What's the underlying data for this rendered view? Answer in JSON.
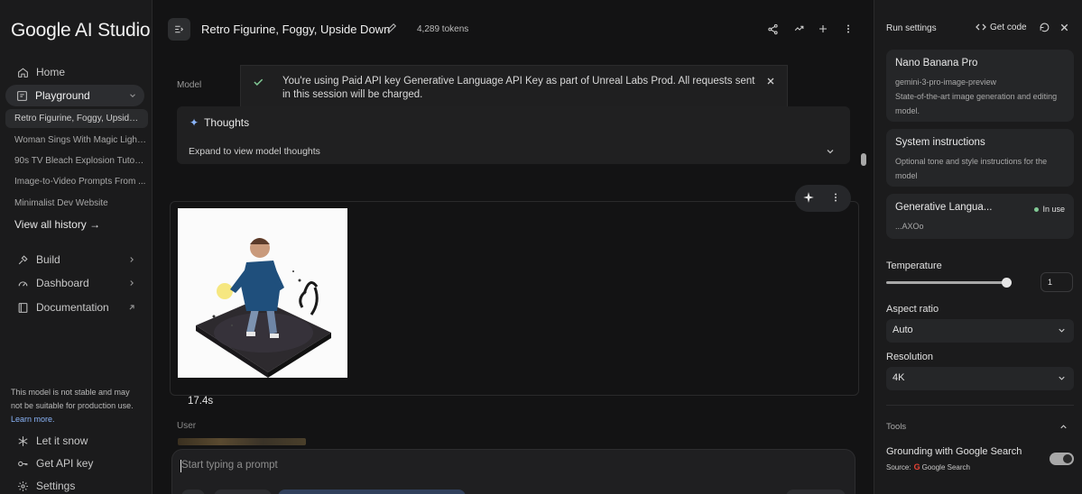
{
  "app": {
    "title": "Google AI Studio"
  },
  "sidebar": {
    "nav": [
      {
        "label": "Home",
        "icon": "home-icon"
      },
      {
        "label": "Playground",
        "icon": "playground-icon"
      }
    ],
    "history": [
      "Retro Figurine, Foggy, Upside D...",
      "Woman Sings With Magic Lights.",
      "90s TV Bleach Explosion Tutorial",
      "Image-to-Video Prompts From ...",
      "Minimalist Dev Website"
    ],
    "view_all": "View all history →",
    "lower_nav": [
      {
        "label": "Build",
        "icon": "build-icon"
      },
      {
        "label": "Dashboard",
        "icon": "dashboard-icon"
      },
      {
        "label": "Documentation",
        "icon": "documentation-icon"
      }
    ],
    "note_text": "This model is not stable and may not be suitable for production use.",
    "note_link": "Learn more.",
    "footer": [
      {
        "label": "Let it snow",
        "icon": "snowflake-icon"
      },
      {
        "label": "Get API key",
        "icon": "key-icon"
      },
      {
        "label": "Settings",
        "icon": "gear-icon"
      }
    ]
  },
  "header": {
    "title": "Retro Figurine, Foggy, Upside Down",
    "tokens": "4,289 tokens"
  },
  "main": {
    "model_label": "Model",
    "toast": "You're using Paid API key Generative Language API Key as part of Unreal Labs Prod. All requests sent in this session will be charged.",
    "thoughts": {
      "title": "Thoughts",
      "expand": "Expand to view model thoughts"
    },
    "elapsed": "17.4s",
    "user_label": "User",
    "prompt_placeholder": "Start typing a prompt"
  },
  "settings": {
    "title": "Run settings",
    "get_code": "Get code",
    "model": {
      "name": "Nano Banana Pro",
      "id": "gemini-3-pro-image-preview",
      "desc": "State-of-the-art image generation and editing model."
    },
    "system": {
      "title": "System instructions",
      "desc": "Optional tone and style instructions for the model"
    },
    "api_key": {
      "name": "Generative Langua...",
      "status": "In use",
      "suffix": "...AXOo"
    },
    "temperature": {
      "label": "Temperature",
      "value": "1",
      "level": 0.97
    },
    "aspect_ratio": {
      "label": "Aspect ratio",
      "value": "Auto"
    },
    "resolution": {
      "label": "Resolution",
      "value": "4K"
    },
    "tools_label": "Tools",
    "grounding": {
      "label": "Grounding with Google Search",
      "source_prefix": "Source:",
      "source": "Google Search",
      "enabled": true
    }
  },
  "colors": {
    "background": "#131314",
    "panel": "#1b1b1c",
    "accent_blue": "#8ab4f8",
    "success_green": "#81c995"
  }
}
